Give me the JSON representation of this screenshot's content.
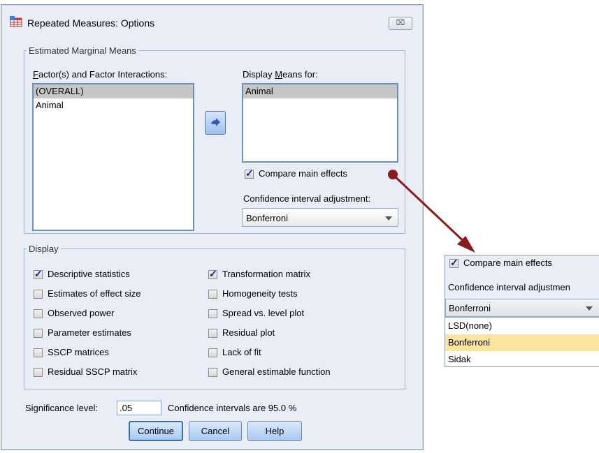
{
  "dialog": {
    "title": "Repeated Measures: Options",
    "close_label": "⌧"
  },
  "emm": {
    "group_label": "Estimated Marginal Means",
    "factors_label": "Factor(s) and Factor Interactions:",
    "factors": [
      {
        "label": "(OVERALL)",
        "selected": true
      },
      {
        "label": "Animal",
        "selected": false
      }
    ],
    "display_label": "Display Means for:",
    "display_items": [
      {
        "label": "Animal",
        "selected": true
      }
    ],
    "compare_label": "Compare main effects",
    "compare_checked": true,
    "ci_label": "Confidence interval adjustment:",
    "ci_value": "Bonferroni"
  },
  "display": {
    "group_label": "Display",
    "left": [
      {
        "label": "Descriptive statistics",
        "checked": true
      },
      {
        "label": "Estimates of effect size",
        "checked": false
      },
      {
        "label": "Observed power",
        "checked": false
      },
      {
        "label": "Parameter estimates",
        "checked": false
      },
      {
        "label": "SSCP matrices",
        "checked": false
      },
      {
        "label": "Residual SSCP matrix",
        "checked": false
      }
    ],
    "right": [
      {
        "label": "Transformation matrix",
        "checked": true
      },
      {
        "label": "Homogeneity tests",
        "checked": false
      },
      {
        "label": "Spread vs. level plot",
        "checked": false
      },
      {
        "label": "Residual plot",
        "checked": false
      },
      {
        "label": "Lack of fit",
        "checked": false
      },
      {
        "label": "General estimable function",
        "checked": false
      }
    ]
  },
  "significance": {
    "label": "Significance level:",
    "value": ".05",
    "ci_text": "Confidence intervals are 95.0 %"
  },
  "buttons": {
    "continue": "Continue",
    "cancel": "Cancel",
    "help": "Help"
  },
  "zoom": {
    "compare_label": "Compare main effects",
    "ci_label": "Confidence interval adjustmen",
    "combo_value": "Bonferroni",
    "options": [
      {
        "label": "LSD(none)",
        "highlighted": false
      },
      {
        "label": "Bonferroni",
        "highlighted": true
      },
      {
        "label": "Sidak",
        "highlighted": false
      }
    ]
  },
  "colors": {
    "dialog_bg": "#e9eef6",
    "callout_arrow": "#8b1a1a",
    "highlight": "#fbe3a0"
  }
}
